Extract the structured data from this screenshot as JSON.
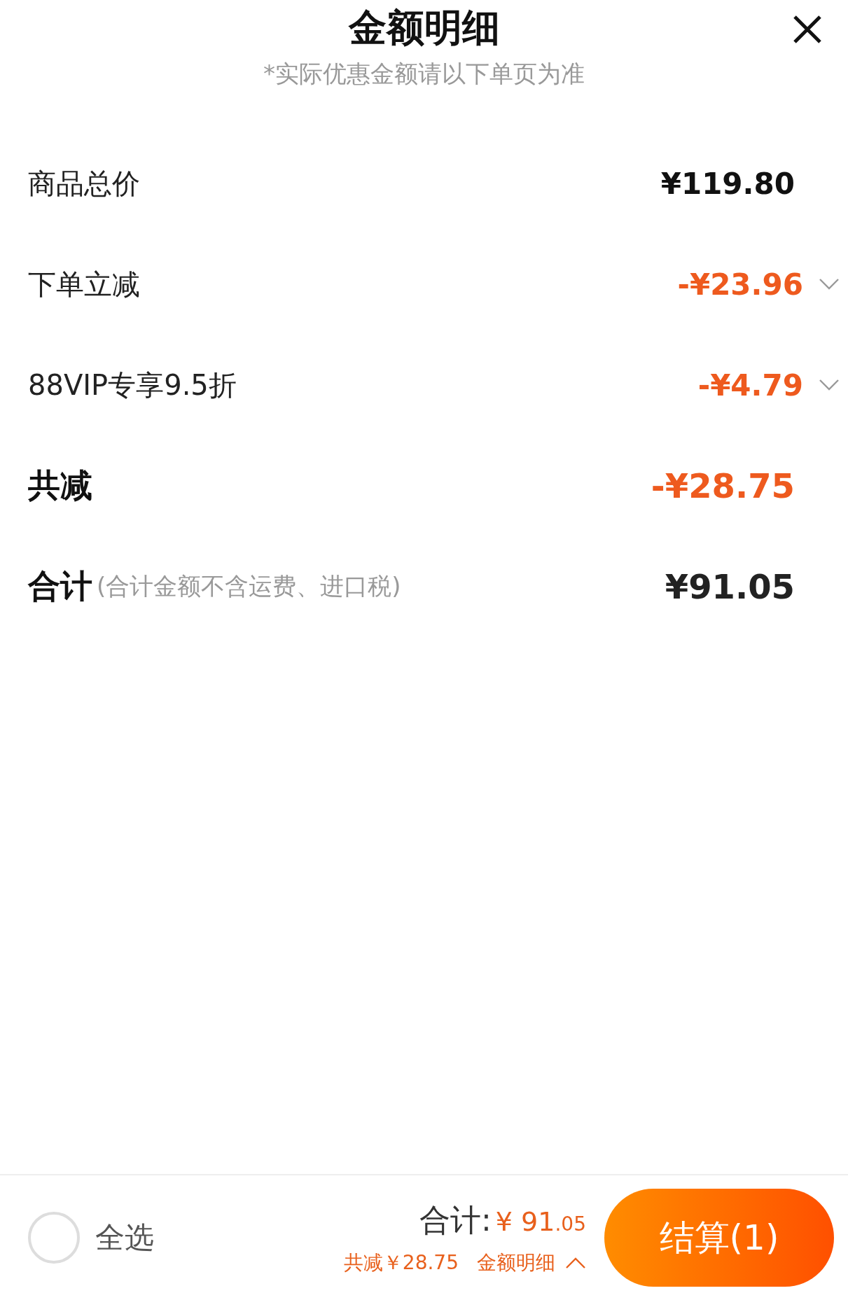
{
  "sheet": {
    "title": "金额明细",
    "subtitle": "*实际优惠金额请以下单页为准"
  },
  "rows": [
    {
      "kind": "price",
      "label": "商品总价",
      "value": "¥119.80"
    },
    {
      "kind": "discount",
      "label": "下单立减",
      "value": "-¥23.96",
      "expanded": false
    },
    {
      "kind": "discount",
      "label": "88VIP专享9.5折",
      "value": "-¥4.79",
      "expanded": false
    },
    {
      "kind": "total_discount",
      "label": "共减",
      "value": "-¥28.75"
    },
    {
      "kind": "total",
      "label": "合计",
      "note": "(合计金额不含运费、进口税)",
      "value": "¥91.05"
    }
  ],
  "bottom_bar": {
    "select_all": {
      "label": "全选",
      "checked": false
    },
    "total_label": "合计:",
    "total_main": "¥ 91",
    "total_small": ".05",
    "discount": "共减￥28.75",
    "details_link": {
      "label": "金额明细",
      "expanded": true
    },
    "checkout_button": "结算(1)"
  }
}
